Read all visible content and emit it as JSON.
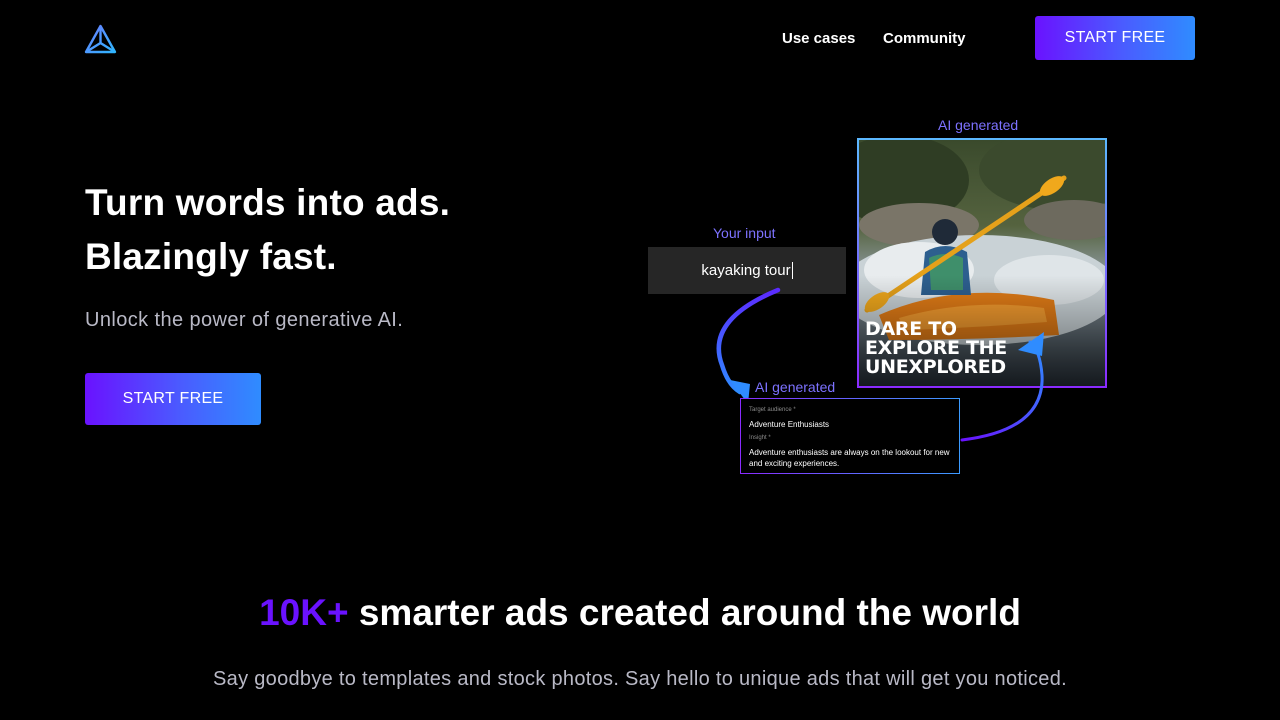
{
  "nav": {
    "links": [
      "Use cases",
      "Community"
    ],
    "cta": "START FREE"
  },
  "hero": {
    "title_line1": "Turn words into ads.",
    "title_line2": "Blazingly fast.",
    "subtitle": "Unlock the power of generative AI.",
    "cta": "START FREE"
  },
  "demo": {
    "input_label": "Your input",
    "input_value": "kayaking tour",
    "ad_label": "AI generated",
    "ad_headline": [
      "DARE TO",
      "EXPLORE THE",
      "UNEXPLORED"
    ],
    "brief_label": "AI generated",
    "brief": {
      "audience_label": "Target audience *",
      "audience_value": "Adventure Enthusiasts",
      "insight_label": "Insight *",
      "insight_value": "Adventure enthusiasts are always on the lookout for new and exciting experiences."
    }
  },
  "stats": {
    "number": "10K+",
    "title_rest": " smarter ads created around the world",
    "subtitle": "Say goodbye to templates and stock photos. Say hello to unique ads that will get you noticed."
  },
  "colors": {
    "accent_purple": "#6a12ff",
    "accent_blue": "#2f8cff",
    "label_violet": "#7d72ff"
  }
}
